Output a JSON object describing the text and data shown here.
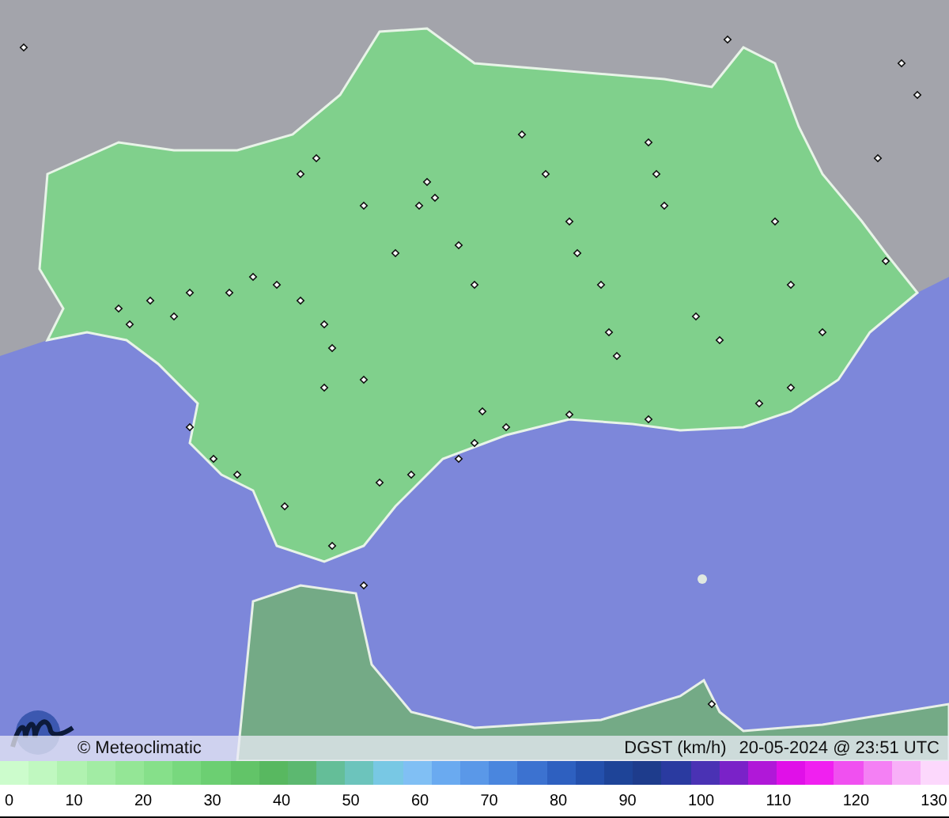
{
  "brand": {
    "text": "© Meteoclimatic"
  },
  "caption": {
    "variable": "DGST (km/h)",
    "timestamp": "20-05-2024 @ 23:51 UTC"
  },
  "legend": {
    "labels": [
      "0",
      "10",
      "20",
      "30",
      "40",
      "50",
      "60",
      "70",
      "80",
      "90",
      "100",
      "110",
      "120",
      "130"
    ]
  }
}
